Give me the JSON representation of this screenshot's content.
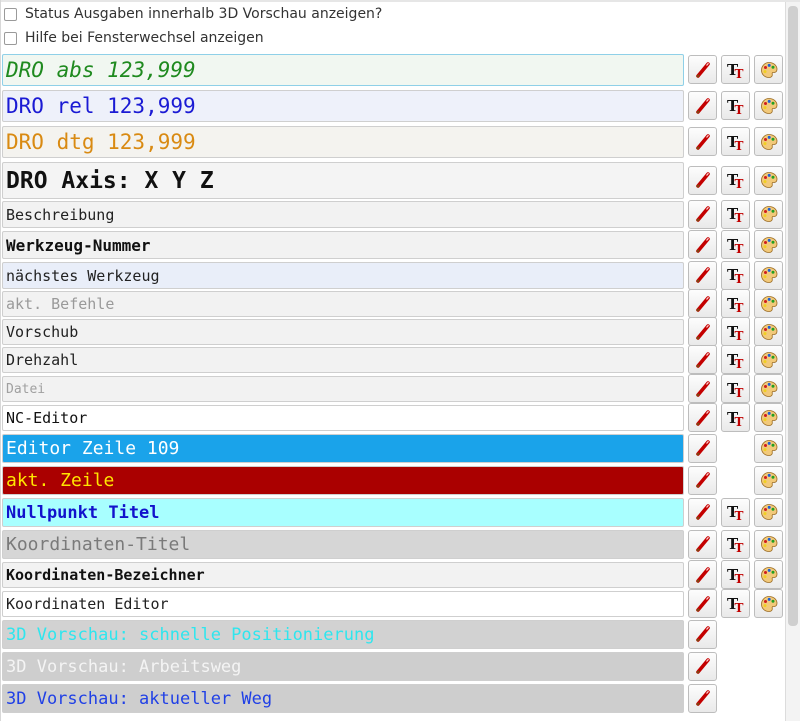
{
  "options": [
    {
      "label": "Status Ausgaben innerhalb 3D Vorschau anzeigen?",
      "checked": false
    },
    {
      "label": "Hilfe bei Fensterwechsel anzeigen",
      "checked": false
    }
  ],
  "rows": [
    {
      "text": "DRO abs 123,999",
      "fg": "#1f8a1f",
      "bg": "#f1f7f1",
      "size": 21,
      "bold": false,
      "italic": true,
      "font": true,
      "color": true
    },
    {
      "text": "DRO rel 123,999",
      "fg": "#1a1ad4",
      "bg": "#eef1fa",
      "size": 21,
      "bold": false,
      "italic": false,
      "font": true,
      "color": true
    },
    {
      "text": "DRO dtg 123,999",
      "fg": "#d98a12",
      "bg": "#f4f3ef",
      "size": 21,
      "bold": false,
      "italic": false,
      "font": true,
      "color": true
    },
    {
      "text": "DRO Axis: X Y Z",
      "fg": "#111111",
      "bg": "#f4f4f4",
      "size": 23,
      "bold": true,
      "italic": false,
      "font": true,
      "color": true
    },
    {
      "text": "Beschreibung",
      "fg": "#222222",
      "bg": "#f2f2f2",
      "size": 15,
      "bold": false,
      "italic": false,
      "font": true,
      "color": true
    },
    {
      "text": "Werkzeug-Nummer",
      "fg": "#111111",
      "bg": "#f2f2f2",
      "size": 16,
      "bold": true,
      "italic": false,
      "font": true,
      "color": true
    },
    {
      "text": "nächstes Werkzeug",
      "fg": "#222222",
      "bg": "#e9eef9",
      "size": 15,
      "bold": false,
      "italic": false,
      "font": true,
      "color": true
    },
    {
      "text": "akt. Befehle",
      "fg": "#9a9a9a",
      "bg": "#f2f2f2",
      "size": 15,
      "bold": false,
      "italic": false,
      "font": true,
      "color": true
    },
    {
      "text": "Vorschub",
      "fg": "#222222",
      "bg": "#f2f2f2",
      "size": 15,
      "bold": false,
      "italic": false,
      "font": true,
      "color": true
    },
    {
      "text": "Drehzahl",
      "fg": "#222222",
      "bg": "#f2f2f2",
      "size": 15,
      "bold": false,
      "italic": false,
      "font": true,
      "color": true
    },
    {
      "text": "Datei",
      "fg": "#a0a0a0",
      "bg": "#f2f2f2",
      "size": 13,
      "bold": false,
      "italic": false,
      "font": true,
      "color": true
    },
    {
      "text": "NC-Editor",
      "fg": "#111111",
      "bg": "#ffffff",
      "size": 15,
      "bold": false,
      "italic": false,
      "font": true,
      "color": true
    },
    {
      "text": "Editor Zeile 109",
      "fg": "#ffffff",
      "bg": "#1aa3ea",
      "size": 18,
      "bold": false,
      "italic": false,
      "font": false,
      "color": true
    },
    {
      "text": "akt. Zeile",
      "fg": "#ffe600",
      "bg": "#aa0000",
      "size": 18,
      "bold": false,
      "italic": false,
      "font": false,
      "color": true
    },
    {
      "text": "Nullpunkt Titel",
      "fg": "#1212cc",
      "bg": "#a8ffff",
      "size": 17,
      "bold": true,
      "italic": false,
      "font": true,
      "color": true
    },
    {
      "text": "Koordinaten-Titel",
      "fg": "#7a7a7a",
      "bg": "#d6d6d6",
      "size": 18,
      "bold": false,
      "italic": false,
      "font": true,
      "color": true
    },
    {
      "text": "Koordinaten-Bezeichner",
      "fg": "#111111",
      "bg": "#f2f2f2",
      "size": 15,
      "bold": true,
      "italic": false,
      "font": true,
      "color": true
    },
    {
      "text": "Koordinaten Editor",
      "fg": "#222222",
      "bg": "#ffffff",
      "size": 15,
      "bold": false,
      "italic": false,
      "font": true,
      "color": true
    },
    {
      "text": "3D Vorschau: schnelle Positionierung",
      "fg": "#2ee6ee",
      "bg": "#d2d2d2",
      "size": 17,
      "bold": false,
      "italic": false,
      "font": false,
      "color": false
    },
    {
      "text": "3D Vorschau: Arbeitsweg",
      "fg": "#f4f4f4",
      "bg": "#cecece",
      "size": 17,
      "bold": false,
      "italic": false,
      "font": false,
      "color": false
    },
    {
      "text": "3D Vorschau: aktueller Weg",
      "fg": "#2040e6",
      "bg": "#cecece",
      "size": 17,
      "bold": false,
      "italic": false,
      "font": false,
      "color": false
    }
  ],
  "icons": {
    "edit": "pencil-icon",
    "font": "font-tt-icon",
    "color": "palette-icon"
  }
}
